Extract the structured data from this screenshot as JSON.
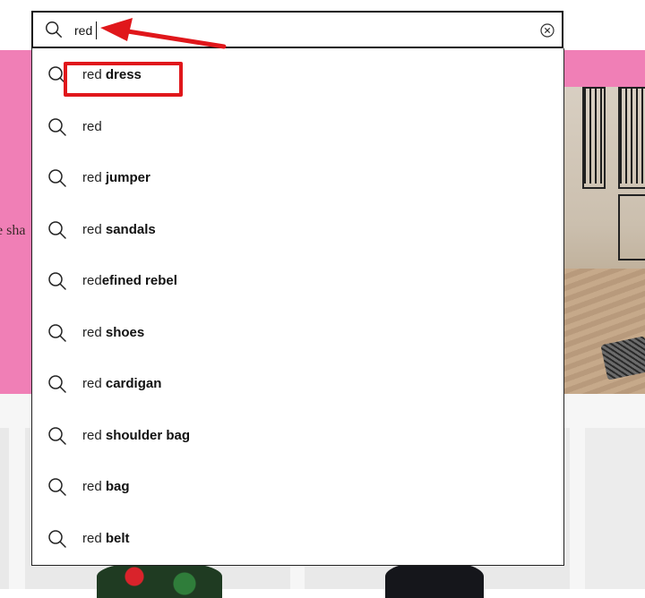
{
  "background": {
    "banner_text": "e sha"
  },
  "search": {
    "value": "red",
    "query_prefix": "red"
  },
  "suggestions": [
    {
      "prefix": "red",
      "rest": " dress"
    },
    {
      "prefix": "red",
      "rest": ""
    },
    {
      "prefix": "red",
      "rest": " jumper"
    },
    {
      "prefix": "red",
      "rest": " sandals"
    },
    {
      "prefix": "red",
      "rest": "efined rebel"
    },
    {
      "prefix": "red",
      "rest": " shoes"
    },
    {
      "prefix": "red",
      "rest": " cardigan"
    },
    {
      "prefix": "red",
      "rest": " shoulder bag"
    },
    {
      "prefix": "red",
      "rest": " bag"
    },
    {
      "prefix": "red",
      "rest": " belt"
    }
  ],
  "icons": {
    "search": "search-icon",
    "clear": "clear-circle-x-icon"
  },
  "colors": {
    "banner": "#f07fb6",
    "annotation": "#e0171b"
  }
}
